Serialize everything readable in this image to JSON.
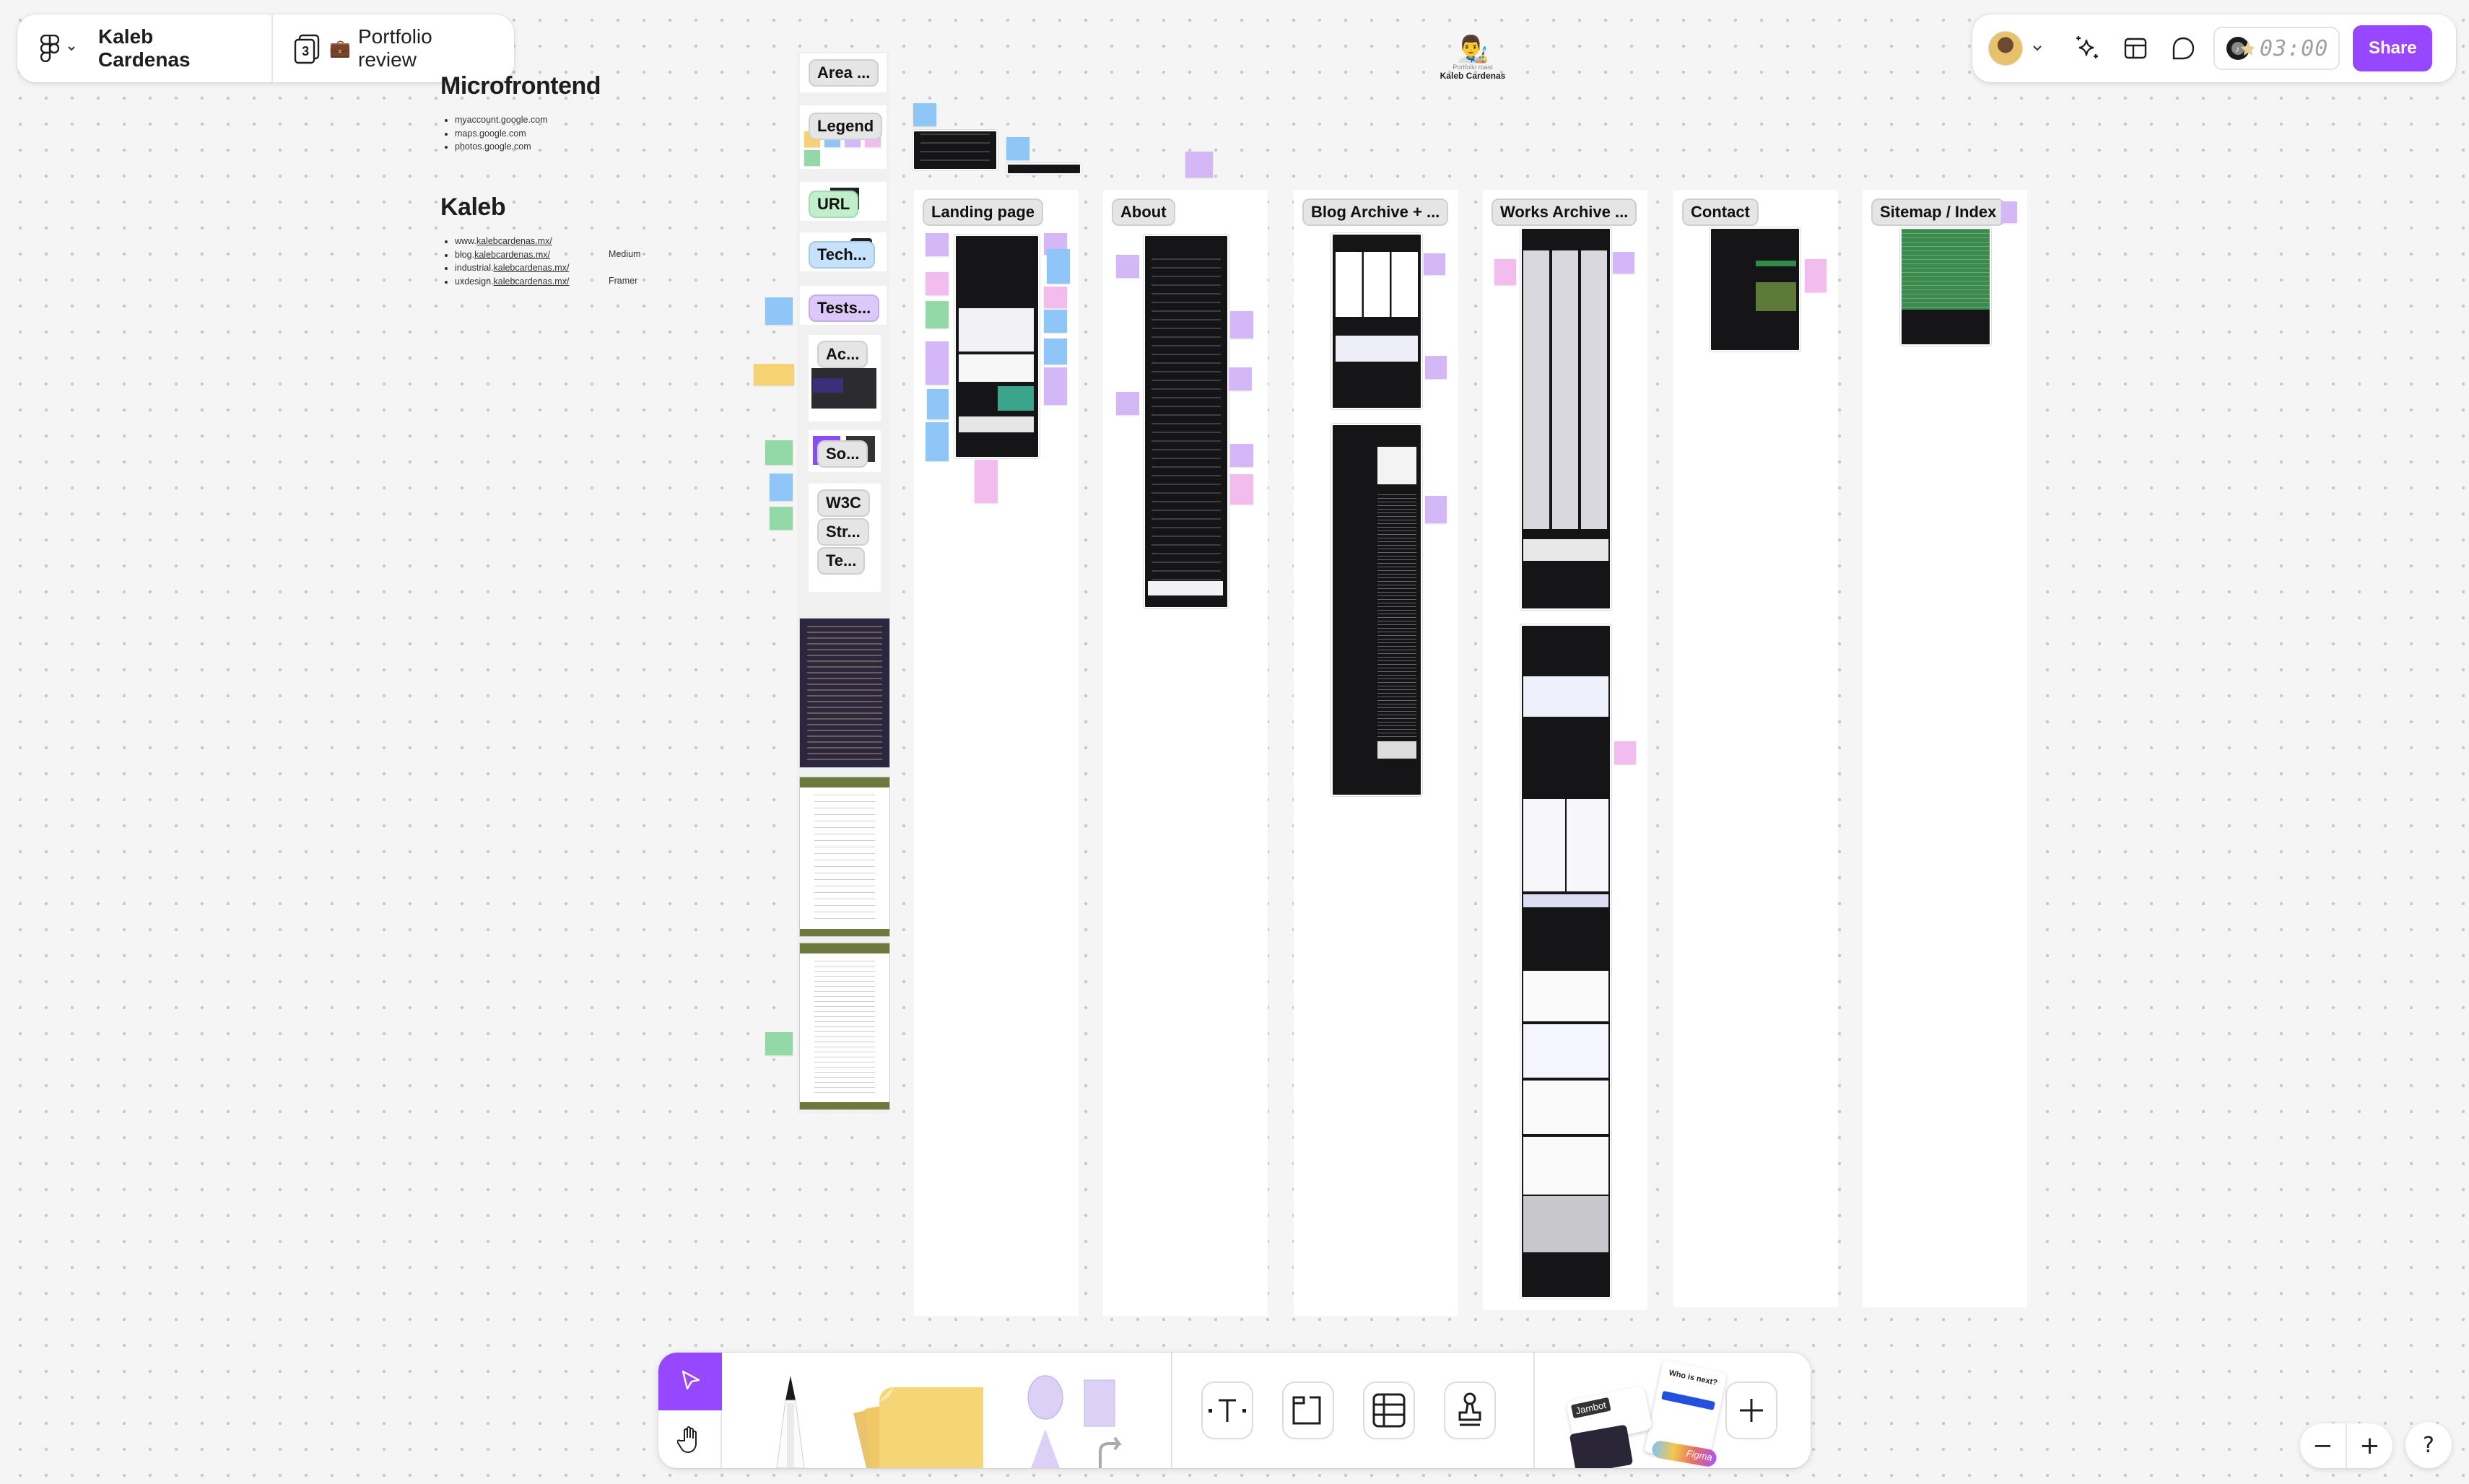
{
  "top_left": {
    "team_name": "Kaleb Cardenas",
    "pages_count": "3",
    "file_emoji": "💼",
    "file_name": "Portfolio review"
  },
  "top_right": {
    "timer": "03:00",
    "share_label": "Share",
    "icons": [
      "avatar",
      "chevron-down-icon",
      "ai-sparkle-icon",
      "layout-icon",
      "comment-icon",
      "music-timer-icon"
    ]
  },
  "presenter": {
    "emoji": "👨‍🎨",
    "subtitle": "Portfolio roast",
    "name": "Kaleb Cardenas"
  },
  "microfrontend": {
    "title": "Microfrontend",
    "links": [
      "myaccount.google.com",
      "maps.google.com",
      "photos.google.com"
    ]
  },
  "kaleb": {
    "title": "Kaleb",
    "links": [
      {
        "prefix": "www.",
        "domain": "kalebcardenas.mx/",
        "note": ""
      },
      {
        "prefix": "blog.",
        "domain": "kalebcardenas.mx/",
        "note": "Medium"
      },
      {
        "prefix": "industrial.",
        "domain": "kalebcardenas.mx/",
        "note": ""
      },
      {
        "prefix": "uxdesign.",
        "domain": "kalebcardenas.mx/",
        "note": "Framer"
      }
    ]
  },
  "left_sections": [
    {
      "label": "Area ..."
    },
    {
      "label": "Legend"
    },
    {
      "label": "URL"
    },
    {
      "label": "Tech..."
    },
    {
      "label": "Tests..."
    },
    {
      "label": "Ac..."
    },
    {
      "label": "So..."
    },
    {
      "label": "W3C"
    },
    {
      "label": "Str..."
    },
    {
      "label": "Te..."
    }
  ],
  "sections": [
    {
      "label": "Landing page"
    },
    {
      "label": "About"
    },
    {
      "label": "Blog Archive + ..."
    },
    {
      "label": "Works Archive ..."
    },
    {
      "label": "Contact"
    },
    {
      "label": "Sitemap / Index"
    }
  ],
  "bottom_toolbar": {
    "tools": [
      "move-tool",
      "hand-tool",
      "marker-tool",
      "sticky-note-tool",
      "shapes-tool",
      "text-tool",
      "section-tool",
      "table-tool",
      "stamp-tool",
      "widgets-tool",
      "more-tool"
    ],
    "widget_labels": {
      "jambot": "Jambot",
      "who_is_next": "Who is next?",
      "figma": "Figma"
    }
  },
  "zoom_controls": {
    "zoom_out": "−",
    "zoom_in": "+",
    "help": "?"
  },
  "colors": {
    "accent": "#9747ff",
    "sticky_blue": "#8ec6f7",
    "sticky_purple": "#d4b7f7",
    "sticky_pink": "#f2bdee",
    "sticky_green": "#93d9a5",
    "sticky_yellow": "#f7d273"
  }
}
